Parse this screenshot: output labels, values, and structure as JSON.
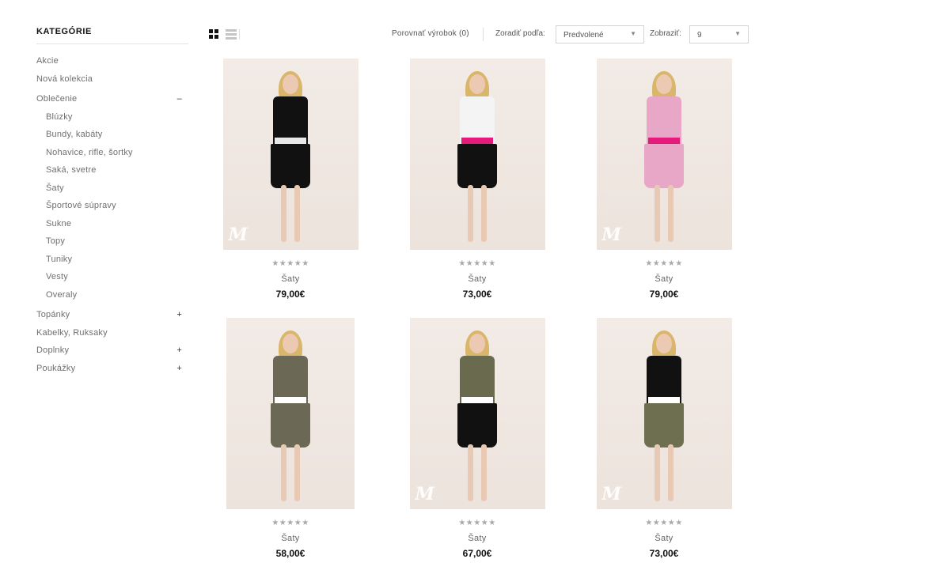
{
  "sidebar": {
    "title": "KATEGÓRIE",
    "items": [
      {
        "label": "Akcie"
      },
      {
        "label": "Nová kolekcia"
      },
      {
        "label": "Oblečenie",
        "toggle": "–"
      },
      {
        "label": "Blúzky"
      },
      {
        "label": "Bundy, kabáty"
      },
      {
        "label": "Nohavice, rifle, šortky"
      },
      {
        "label": "Saká, svetre"
      },
      {
        "label": "Šaty"
      },
      {
        "label": "Športové súpravy"
      },
      {
        "label": "Sukne"
      },
      {
        "label": "Topy"
      },
      {
        "label": "Tuniky"
      },
      {
        "label": "Vesty"
      },
      {
        "label": "Overaly"
      },
      {
        "label": "Topánky",
        "toggle": "+"
      },
      {
        "label": "Kabelky, Ruksaky"
      },
      {
        "label": "Doplnky",
        "toggle": "+"
      },
      {
        "label": "Poukážky",
        "toggle": "+"
      }
    ]
  },
  "toolbar": {
    "compare_label": "Porovnať výrobok (0)",
    "sort_label": "Zoradiť podľa:",
    "sort_value": "Predvolené",
    "show_label": "Zobraziť:",
    "show_value": "9"
  },
  "icons": {
    "grid_view": "grid-view-icon",
    "list_view": "list-view-icon",
    "caret": "▼",
    "star": "★"
  },
  "products": [
    {
      "name": "Šaty",
      "price": "79,00€",
      "rating": 0,
      "stars": "★★★★★",
      "outfit": {
        "top": "#111111",
        "skirt": "#111111",
        "accent": "#e8e8e8"
      }
    },
    {
      "name": "Šaty",
      "price": "73,00€",
      "rating": 0,
      "stars": "★★★★★",
      "outfit": {
        "top": "#f4f4f4",
        "skirt": "#111111",
        "accent": "#e6197c"
      }
    },
    {
      "name": "Šaty",
      "price": "79,00€",
      "rating": 0,
      "stars": "★★★★★",
      "outfit": {
        "top": "#e9a7c8",
        "skirt": "#e9a7c8",
        "accent": "#e6197c"
      }
    },
    {
      "name": "Šaty",
      "price": "58,00€",
      "rating": 0,
      "stars": "★★★★★",
      "outfit": {
        "top": "#6b6955",
        "skirt": "#6b6955",
        "accent": "#ffffff"
      }
    },
    {
      "name": "Šaty",
      "price": "67,00€",
      "rating": 0,
      "stars": "★★★★★",
      "outfit": {
        "top": "#6a6a4e",
        "skirt": "#111111",
        "accent": "#ffffff"
      }
    },
    {
      "name": "Šaty",
      "price": "73,00€",
      "rating": 0,
      "stars": "★★★★★",
      "outfit": {
        "top": "#111111",
        "skirt": "#6e6e50",
        "accent": "#ffffff"
      }
    }
  ],
  "colors": {
    "brand_text": "#111111",
    "muted": "#6f6f6f",
    "border": "#d5d5d5"
  }
}
